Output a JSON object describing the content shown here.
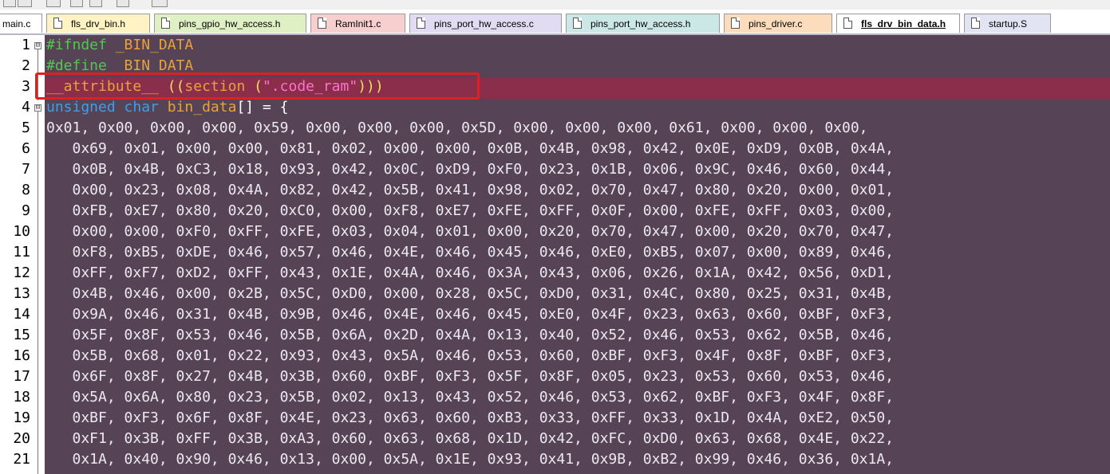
{
  "tabs": [
    {
      "label": "main.c",
      "color": "#ffffff"
    },
    {
      "label": "fls_drv_bin.h",
      "color": "#fff3c4"
    },
    {
      "label": "pins_gpio_hw_access.h",
      "color": "#dff0c4"
    },
    {
      "label": "RamInit1.c",
      "color": "#f7cfcf"
    },
    {
      "label": "pins_port_hw_access.c",
      "color": "#e2dcf3"
    },
    {
      "label": "pins_port_hw_access.h",
      "color": "#cce8e6"
    },
    {
      "label": "pins_driver.c",
      "color": "#fbdcbc"
    },
    {
      "label": "fls_drv_bin_data.h",
      "color": "#ffffff"
    },
    {
      "label": "startup.S",
      "color": "#e2e4f4"
    }
  ],
  "active_tab": "fls_drv_bin_data.h",
  "editor": {
    "line_numbers": [
      "1",
      "2",
      "3",
      "4",
      "5",
      "6",
      "7",
      "8",
      "9",
      "10",
      "11",
      "12",
      "13",
      "14",
      "15",
      "16",
      "17",
      "18",
      "19",
      "20",
      "21"
    ],
    "code": {
      "line1": {
        "directive": "#ifndef",
        "macro": "_BIN_DATA"
      },
      "line2": {
        "directive": "#define",
        "macro": "_BIN_DATA"
      },
      "line3": {
        "attr": "__attribute__",
        "open": "((",
        "section": "section",
        "lp": " (",
        "string": "\".code_ram\"",
        "close": ")))"
      },
      "line4": {
        "kw1": "unsigned",
        "kw2": "char",
        "ident": "bin_data",
        "rest": "[] = {"
      },
      "data_lines": [
        "0x01, 0x00, 0x00, 0x00, 0x59, 0x00, 0x00, 0x00, 0x5D, 0x00, 0x00, 0x00, 0x61, 0x00, 0x00, 0x00,",
        "   0x69, 0x01, 0x00, 0x00, 0x81, 0x02, 0x00, 0x00, 0x0B, 0x4B, 0x98, 0x42, 0x0E, 0xD9, 0x0B, 0x4A,",
        "   0x0B, 0x4B, 0xC3, 0x18, 0x93, 0x42, 0x0C, 0xD9, 0xF0, 0x23, 0x1B, 0x06, 0x9C, 0x46, 0x60, 0x44,",
        "   0x00, 0x23, 0x08, 0x4A, 0x82, 0x42, 0x5B, 0x41, 0x98, 0x02, 0x70, 0x47, 0x80, 0x20, 0x00, 0x01,",
        "   0xFB, 0xE7, 0x80, 0x20, 0xC0, 0x00, 0xF8, 0xE7, 0xFE, 0xFF, 0x0F, 0x00, 0xFE, 0xFF, 0x03, 0x00,",
        "   0x00, 0x00, 0xF0, 0xFF, 0xFE, 0x03, 0x04, 0x01, 0x00, 0x20, 0x70, 0x47, 0x00, 0x20, 0x70, 0x47,",
        "   0xF8, 0xB5, 0xDE, 0x46, 0x57, 0x46, 0x4E, 0x46, 0x45, 0x46, 0xE0, 0xB5, 0x07, 0x00, 0x89, 0x46,",
        "   0xFF, 0xF7, 0xD2, 0xFF, 0x43, 0x1E, 0x4A, 0x46, 0x3A, 0x43, 0x06, 0x26, 0x1A, 0x42, 0x56, 0xD1,",
        "   0x4B, 0x46, 0x00, 0x2B, 0x5C, 0xD0, 0x00, 0x28, 0x5C, 0xD0, 0x31, 0x4C, 0x80, 0x25, 0x31, 0x4B,",
        "   0x9A, 0x46, 0x31, 0x4B, 0x9B, 0x46, 0x4E, 0x46, 0x45, 0xE0, 0x4F, 0x23, 0x63, 0x60, 0xBF, 0xF3,",
        "   0x5F, 0x8F, 0x53, 0x46, 0x5B, 0x6A, 0x2D, 0x4A, 0x13, 0x40, 0x52, 0x46, 0x53, 0x62, 0x5B, 0x46,",
        "   0x5B, 0x68, 0x01, 0x22, 0x93, 0x43, 0x5A, 0x46, 0x53, 0x60, 0xBF, 0xF3, 0x4F, 0x8F, 0xBF, 0xF3,",
        "   0x6F, 0x8F, 0x27, 0x4B, 0x3B, 0x60, 0xBF, 0xF3, 0x5F, 0x8F, 0x05, 0x23, 0x53, 0x60, 0x53, 0x46,",
        "   0x5A, 0x6A, 0x80, 0x23, 0x5B, 0x02, 0x13, 0x43, 0x52, 0x46, 0x53, 0x62, 0xBF, 0xF3, 0x4F, 0x8F,",
        "   0xBF, 0xF3, 0x6F, 0x8F, 0x4E, 0x23, 0x63, 0x60, 0xB3, 0x33, 0xFF, 0x33, 0x1D, 0x4A, 0xE2, 0x50,",
        "   0xF1, 0x3B, 0xFF, 0x3B, 0xA3, 0x60, 0x63, 0x68, 0x1D, 0x42, 0xFC, 0xD0, 0x63, 0x68, 0x4E, 0x22,",
        "   0x1A, 0x40, 0x90, 0x46, 0x13, 0x00, 0x5A, 0x1E, 0x93, 0x41, 0x9B, 0xB2, 0x99, 0x46, 0x36, 0x1A,"
      ]
    },
    "fold_markers": [
      "⊟",
      "⊟"
    ]
  },
  "colors": {
    "editor_bg": "#574356",
    "highlight_line": "#8b2e4c",
    "annotation_box": "#e02020",
    "keyword": "#3f9ee8",
    "preprocessor": "#4ec94e",
    "string": "#ff70d0"
  }
}
